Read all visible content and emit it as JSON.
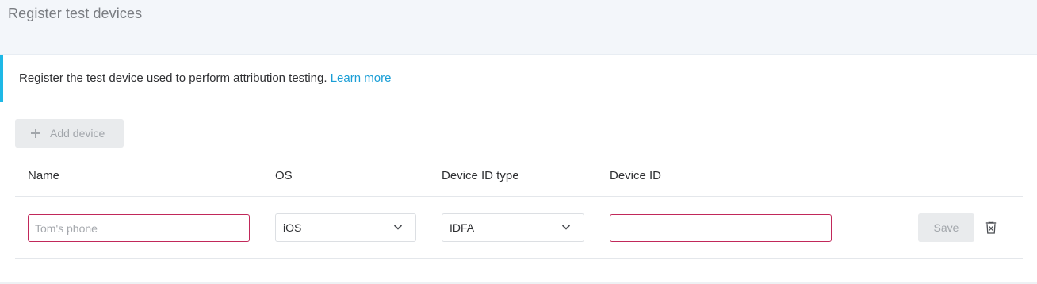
{
  "header": {
    "title": "Register test devices"
  },
  "banner": {
    "text": "Register the test device used to perform attribution testing.",
    "link_label": "Learn more",
    "accent_color": "#1eb8e6",
    "link_color": "#1a9ed6"
  },
  "toolbar": {
    "add_device_label": "Add device",
    "add_icon": "plus-icon"
  },
  "table": {
    "columns": [
      "Name",
      "OS",
      "Device ID type",
      "Device ID"
    ],
    "rows": [
      {
        "name_value": "",
        "name_placeholder": "Tom's phone",
        "os_selected": "iOS",
        "device_id_type_selected": "IDFA",
        "device_id_value": "",
        "save_label": "Save",
        "delete_icon": "trash-icon"
      }
    ]
  },
  "colors": {
    "invalid_border": "#c1285a",
    "disabled_button_bg": "#e9ebed",
    "disabled_text": "#a2a6ab"
  }
}
